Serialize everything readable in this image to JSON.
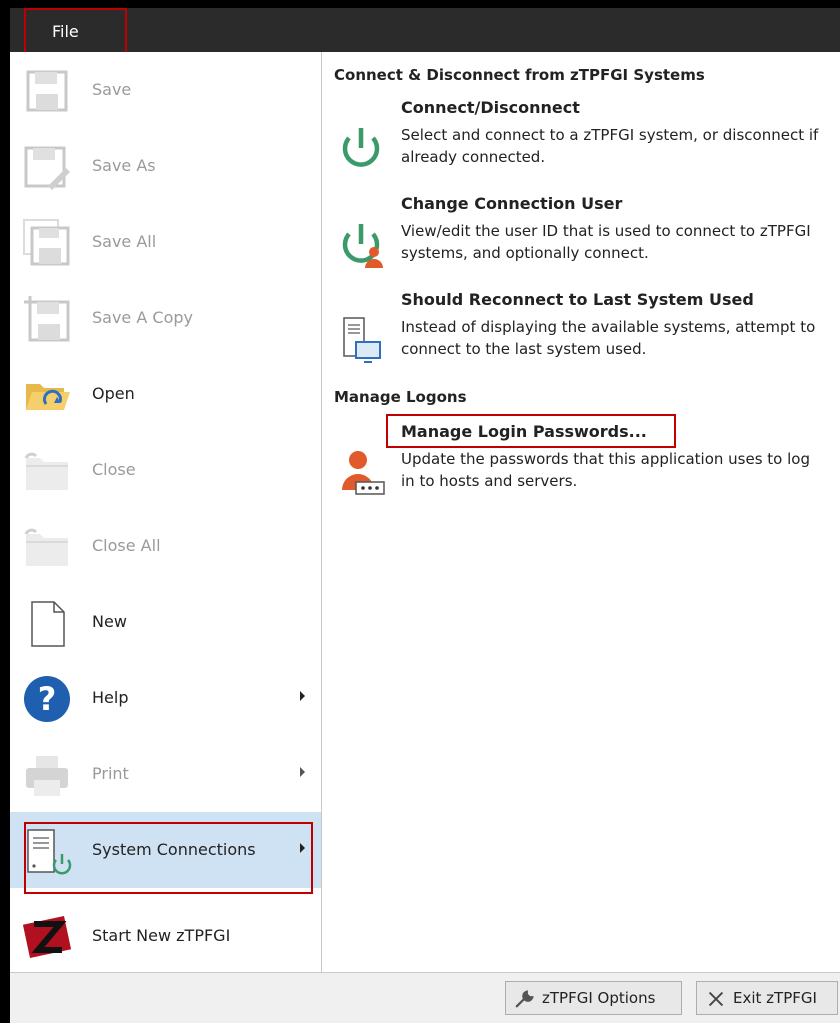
{
  "menubar": {
    "file_label": "File"
  },
  "left_menu": {
    "save": "Save",
    "save_as": "Save As",
    "save_all": "Save All",
    "save_copy": "Save A Copy",
    "open": "Open",
    "close": "Close",
    "close_all": "Close All",
    "new": "New",
    "help": "Help",
    "print": "Print",
    "system_connections": "System Connections",
    "start_new": "Start New zTPFGI"
  },
  "right_panel": {
    "section1_title": "Connect & Disconnect from zTPFGI Systems",
    "connect": {
      "title": "Connect/Disconnect",
      "desc": "Select and connect to a zTPFGI system, or disconnect if already connected."
    },
    "change_user": {
      "title": "Change Connection User",
      "desc": "View/edit the user ID that is used to connect to zTPFGI systems, and optionally connect."
    },
    "reconnect": {
      "title": "Should Reconnect to Last System Used",
      "desc": "Instead of displaying the available systems, attempt to connect to the last system used."
    },
    "section2_title": "Manage Logons",
    "passwords": {
      "title": "Manage Login Passwords...",
      "desc": "Update the passwords that this application uses to log in to hosts and servers."
    }
  },
  "footer": {
    "options_label": "zTPFGI Options",
    "exit_label": "Exit zTPFGI"
  },
  "colors": {
    "highlight_outline": "#c00000",
    "selected_bg": "#cfe2f3",
    "power_icon": "#3a9a6a",
    "user_icon": "#e05a2b"
  }
}
